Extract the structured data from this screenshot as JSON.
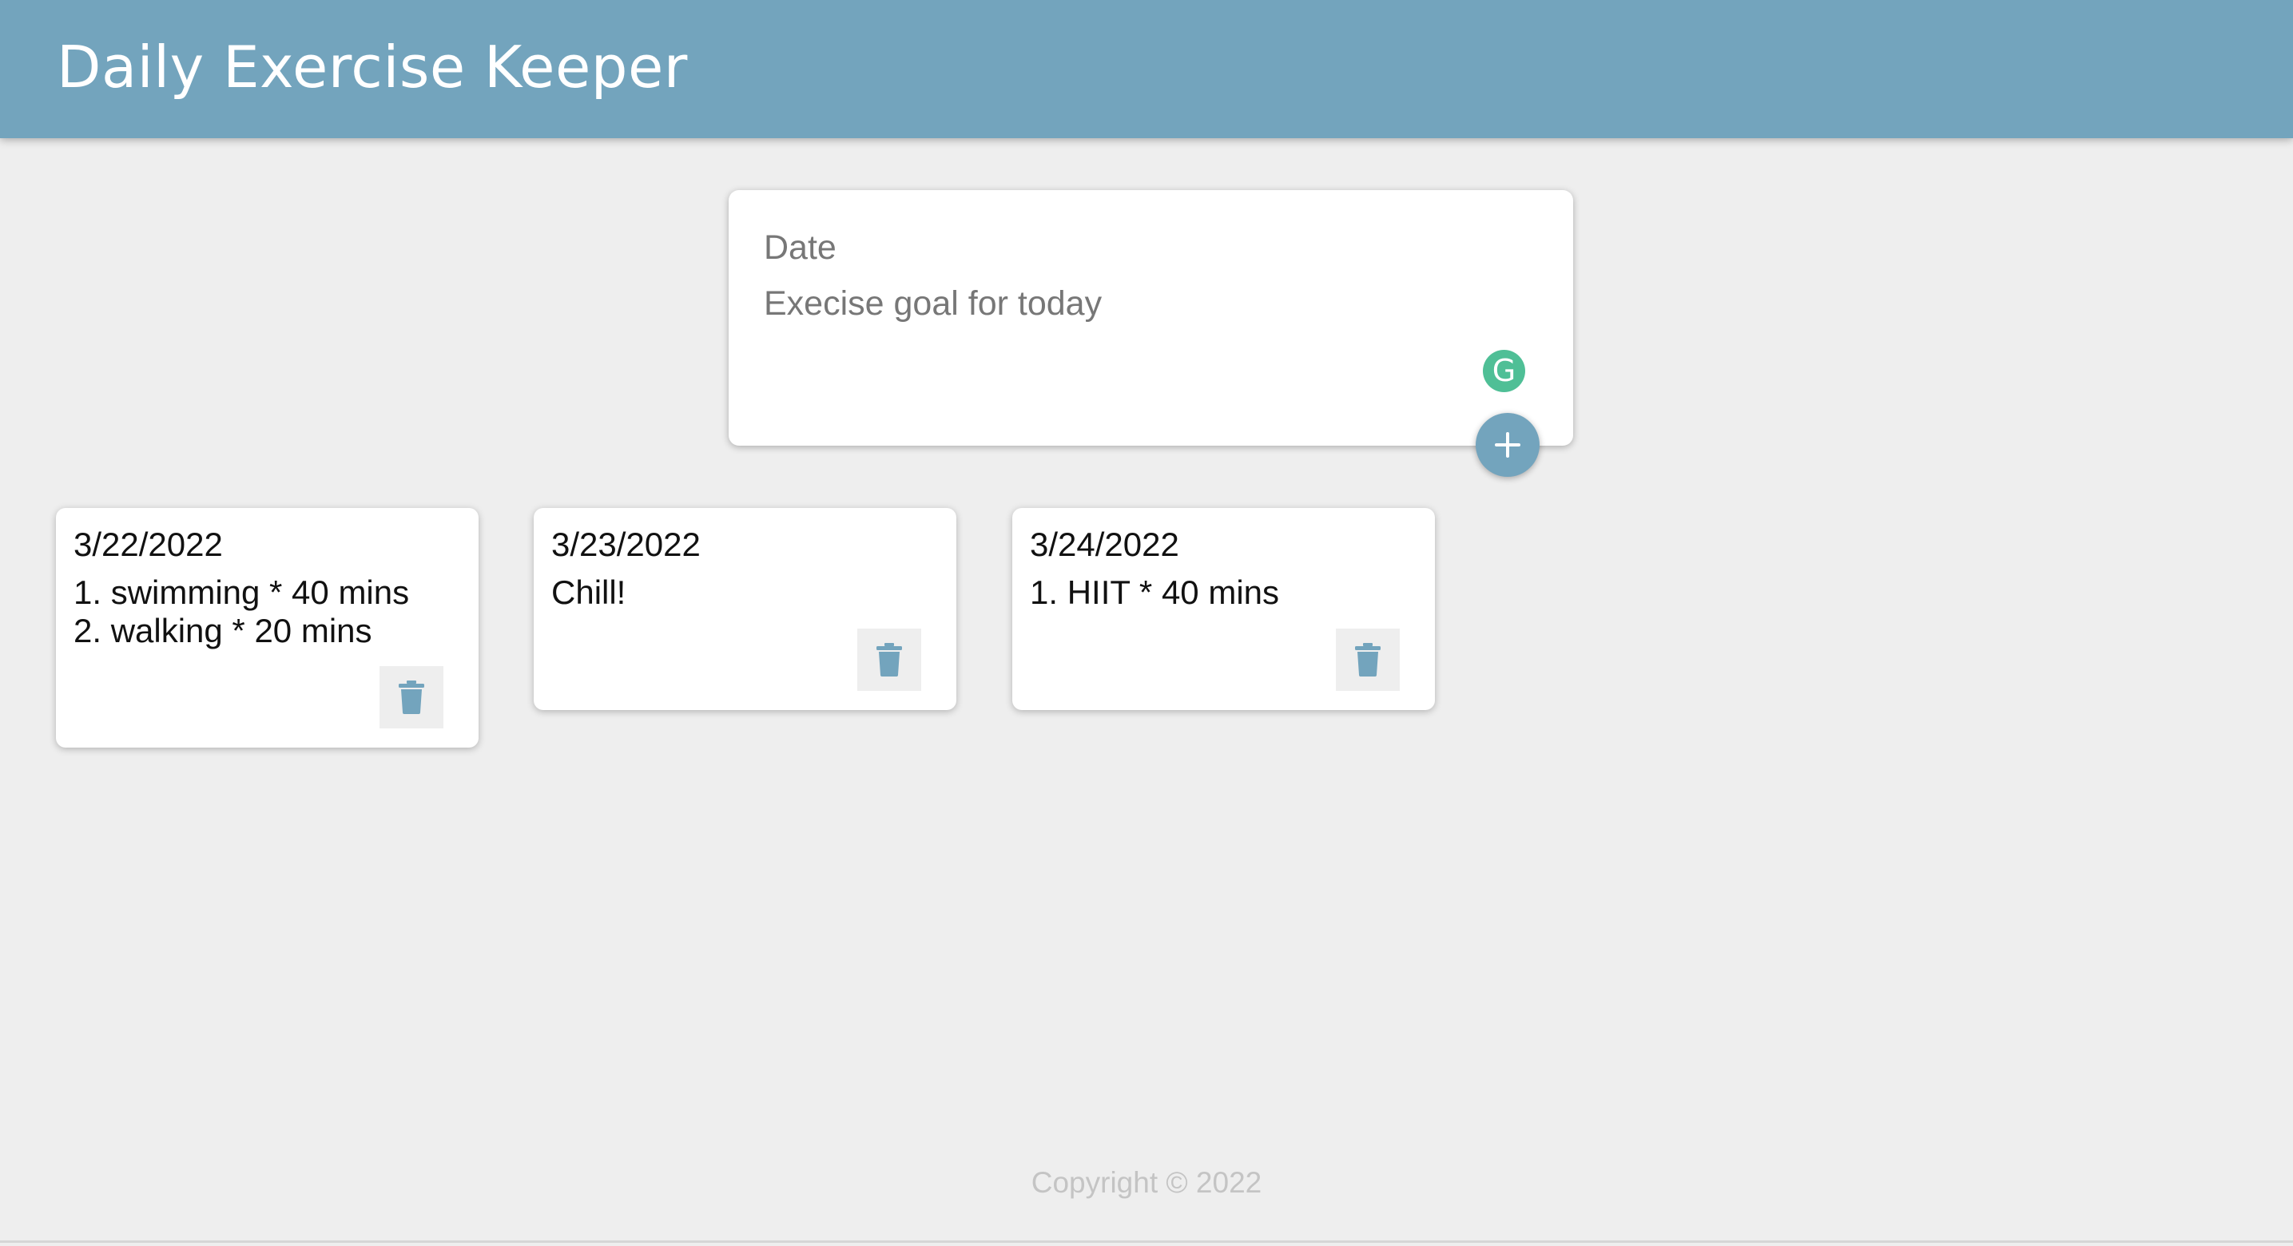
{
  "header": {
    "title": "Daily Exercise Keeper"
  },
  "form": {
    "date_placeholder": "Date",
    "goal_placeholder": "Execise goal for today",
    "grammarly_letter": "G",
    "add_icon": "plus-icon"
  },
  "notes": [
    {
      "date": "3/22/2022",
      "lines": [
        "1. swimming * 40 mins",
        "2. walking * 20 mins"
      ],
      "delete_icon": "trash-icon"
    },
    {
      "date": "3/23/2022",
      "lines": [
        "Chill!"
      ],
      "delete_icon": "trash-icon"
    },
    {
      "date": "3/24/2022",
      "lines": [
        "1. HIIT * 40 mins"
      ],
      "delete_icon": "trash-icon"
    }
  ],
  "footer": {
    "text": "Copyright © 2022"
  },
  "colors": {
    "brand": "#73a4bd",
    "background": "#eeeeee",
    "grammarly": "#4fbf96"
  }
}
